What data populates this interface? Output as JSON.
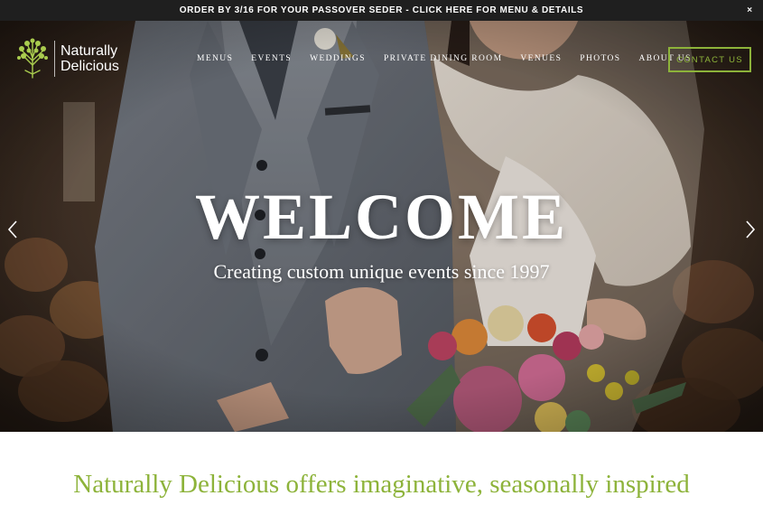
{
  "announcement": {
    "text": "ORDER BY 3/16 FOR YOUR PASSOVER SEDER - CLICK HERE FOR MENU & DETAILS",
    "close_label": "×"
  },
  "logo": {
    "line1": "Naturally",
    "line2": "Delicious",
    "icon": "tree-icon"
  },
  "nav": {
    "items": [
      {
        "label": "MENUS"
      },
      {
        "label": "EVENTS"
      },
      {
        "label": "WEDDINGS"
      },
      {
        "label": "PRIVATE DINING ROOM"
      },
      {
        "label": "VENUES"
      },
      {
        "label": "PHOTOS"
      },
      {
        "label": "ABOUT US"
      }
    ],
    "contact_label": "CONTACT US"
  },
  "hero": {
    "title": "WELCOME",
    "subtitle": "Creating custom unique events since 1997",
    "prev_icon": "chevron-left-icon",
    "next_icon": "chevron-right-icon"
  },
  "intro": {
    "text": "Naturally Delicious offers imaginative, seasonally inspired"
  },
  "colors": {
    "accent": "#8db33a",
    "topbar": "#1f1f1f",
    "white": "#ffffff"
  }
}
